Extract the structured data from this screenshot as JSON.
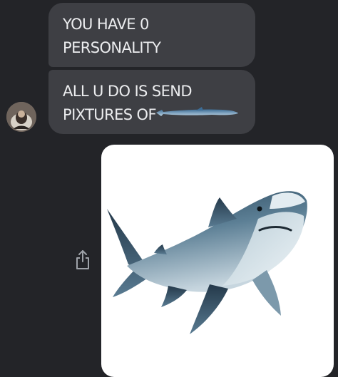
{
  "messages": [
    {
      "sender": "other",
      "lines": [
        "YOU HAVE 0",
        "PERSONALITY"
      ]
    },
    {
      "sender": "other",
      "lines": [
        "ALL U DO IS SEND",
        "PIXTURES OF"
      ],
      "inline_image": "shark-emoji"
    }
  ],
  "attachment": {
    "type": "image",
    "subject": "shark"
  },
  "icons": {
    "share": "share-icon",
    "avatar": "avatar-icon"
  },
  "colors": {
    "background": "#232428",
    "bubble": "#3e3f44",
    "text": "#ecedef",
    "card": "#ffffff"
  }
}
